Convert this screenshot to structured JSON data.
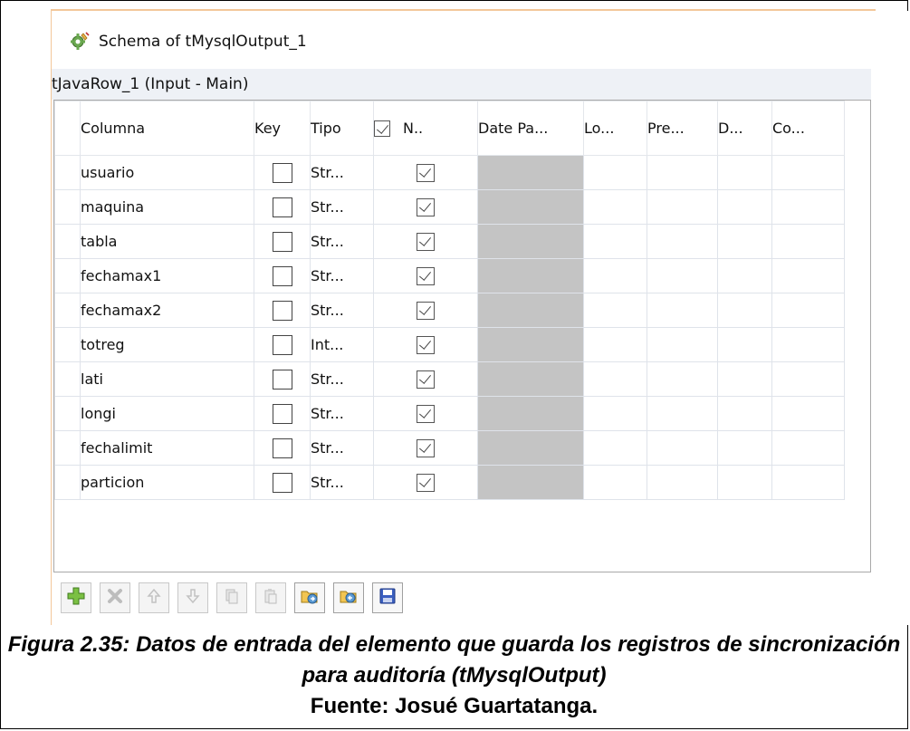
{
  "window": {
    "title": "Schema of tMysqlOutput_1",
    "input_label": "tJavaRow_1 (Input - Main)"
  },
  "table": {
    "columns": [
      "Columna",
      "Key",
      "Tipo",
      "N..",
      "Date Pa...",
      "Lo...",
      "Pre...",
      "D...",
      "Co..."
    ],
    "rows": [
      {
        "name": "usuario",
        "type": "Str..."
      },
      {
        "name": "maquina",
        "type": "Str..."
      },
      {
        "name": "tabla",
        "type": "Str..."
      },
      {
        "name": "fechamax1",
        "type": "Str..."
      },
      {
        "name": "fechamax2",
        "type": "Str..."
      },
      {
        "name": "totreg",
        "type": "Int..."
      },
      {
        "name": "lati",
        "type": "Str..."
      },
      {
        "name": "longi",
        "type": "Str..."
      },
      {
        "name": "fechalimit",
        "type": "Str..."
      },
      {
        "name": "particion",
        "type": "Str..."
      }
    ]
  },
  "toolbar": {
    "icons": [
      "add-icon",
      "remove-icon",
      "move-up-icon",
      "move-down-icon",
      "copy-icon",
      "paste-icon",
      "import-icon",
      "export-icon",
      "save-icon"
    ]
  },
  "caption": {
    "figure": "Figura 2.35: Datos de entrada del elemento que guarda los registros de sincronización para auditoría (tMysqlOutput)",
    "source": "Fuente: Josué Guartatanga."
  },
  "colors": {
    "accent_frame": "#f3c79a",
    "grey_cell": "#c4c4c4",
    "input_bar": "#eef1f6"
  }
}
